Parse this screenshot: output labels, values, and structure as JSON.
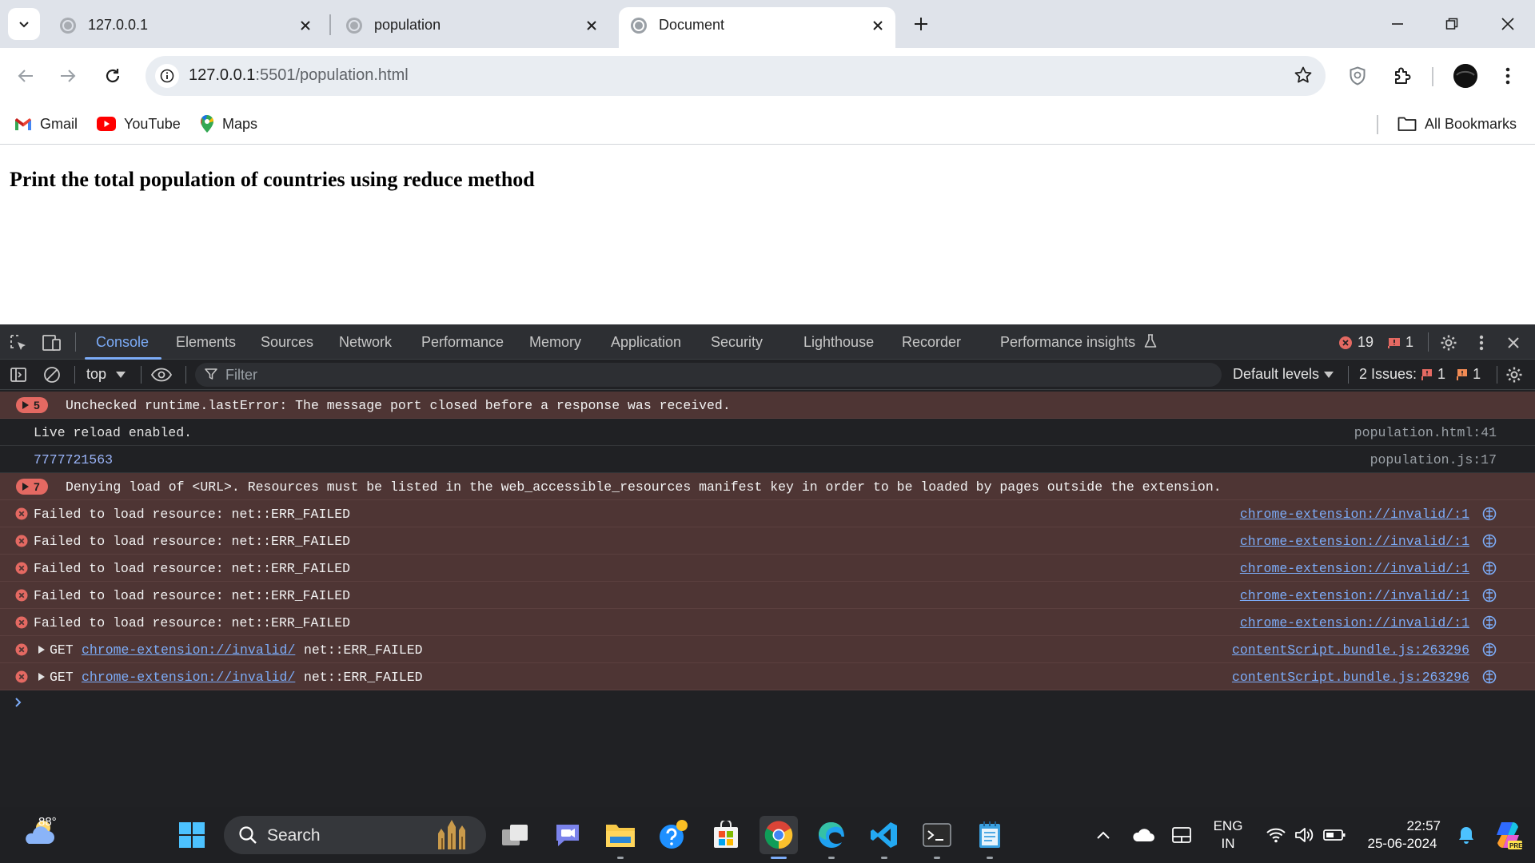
{
  "browser": {
    "tabs": [
      {
        "title": "127.0.0.1",
        "active": false
      },
      {
        "title": "population",
        "active": false
      },
      {
        "title": "Document",
        "active": true
      }
    ],
    "url_host": "127.0.0.1",
    "url_rest": ":5501/population.html",
    "bookmarks": [
      "Gmail",
      "YouTube",
      "Maps"
    ],
    "all_bookmarks": "All Bookmarks"
  },
  "page": {
    "heading": "Print the total population of countries using reduce method"
  },
  "devtools": {
    "tabs": [
      "Console",
      "Elements",
      "Sources",
      "Network",
      "Performance",
      "Memory",
      "Application",
      "Security",
      "Lighthouse",
      "Recorder",
      "Performance insights"
    ],
    "active_tab": "Console",
    "error_count": "19",
    "issue_count": "1",
    "context": "top",
    "filter_placeholder": "Filter",
    "levels": "Default levels",
    "issues_label": "2 Issues:",
    "issues_errors": "1",
    "issues_warnings": "1",
    "console": {
      "grouped1": {
        "count": "5",
        "text": "Unchecked runtime.lastError: The message port closed before a response was received."
      },
      "log1": {
        "text": "Live reload enabled.",
        "source": "population.html:41"
      },
      "log2": {
        "text": "7777721563",
        "source": "population.js:17"
      },
      "grouped2": {
        "count": "7",
        "text": "Denying load of <URL>. Resources must be listed in the web_accessible_resources manifest key in order to be loaded by pages outside the extension."
      },
      "failed": [
        {
          "text": "Failed to load resource: net::ERR_FAILED",
          "source": "chrome-extension://invalid/:1"
        },
        {
          "text": "Failed to load resource: net::ERR_FAILED",
          "source": "chrome-extension://invalid/:1"
        },
        {
          "text": "Failed to load resource: net::ERR_FAILED",
          "source": "chrome-extension://invalid/:1"
        },
        {
          "text": "Failed to load resource: net::ERR_FAILED",
          "source": "chrome-extension://invalid/:1"
        },
        {
          "text": "Failed to load resource: net::ERR_FAILED",
          "source": "chrome-extension://invalid/:1"
        }
      ],
      "gets": [
        {
          "method": "GET",
          "url": "chrome-extension://invalid/",
          "status": "net::ERR_FAILED",
          "source": "contentScript.bundle.js:263296"
        },
        {
          "method": "GET",
          "url": "chrome-extension://invalid/",
          "status": "net::ERR_FAILED",
          "source": "contentScript.bundle.js:263296"
        }
      ]
    }
  },
  "taskbar": {
    "weather_temp": "88°",
    "search": "Search",
    "lang1": "ENG",
    "lang2": "IN",
    "time": "22:57",
    "date": "25-06-2024"
  }
}
